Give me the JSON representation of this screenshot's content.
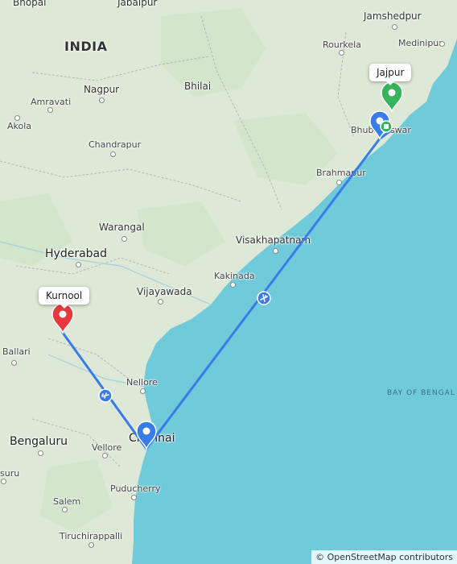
{
  "map": {
    "country_label": "INDIA",
    "sea_label": "BAY OF BENGAL",
    "cities": {
      "bhopal": "Bhopal",
      "jabalpur": "Jabalpur",
      "jamshedpur": "Jamshedpur",
      "rourkela": "Rourkela",
      "medinipur": "Medinipur",
      "nagpur": "Nagpur",
      "bhilai": "Bhilai",
      "amravati": "Amravati",
      "akola": "Akola",
      "chandrapur": "Chandrapur",
      "bhubaneswar": "Bhubaneswar",
      "brahmapur": "Brahmapur",
      "warangal": "Warangal",
      "visakhapatnam": "Visakhapatnam",
      "hyderabad": "Hyderabad",
      "kakinada": "Kakinada",
      "vijayawada": "Vijayawada",
      "ballari": "Ballari",
      "nellore": "Nellore",
      "bengaluru": "Bengaluru",
      "chennai": "Chennai",
      "vellore": "Vellore",
      "suru": "suru",
      "puducherry": "Puducherry",
      "salem": "Salem",
      "tiruchirappalli": "Tiruchirappalli"
    }
  },
  "markers": {
    "origin": {
      "label": "Kurnool",
      "color": "#e8383d"
    },
    "destination": {
      "label": "Jajpur",
      "color": "#35b45c"
    },
    "stopover": "Chennai",
    "stopover2": "Bhubaneswar",
    "waypoint_color": "#3a7bea"
  },
  "route": {
    "color": "#3a7bea",
    "legs": [
      "Kurnool → Chennai",
      "Chennai → Bhubaneswar",
      "Bhubaneswar → Jajpur"
    ],
    "mode_icon": "airplane-icon"
  },
  "colors": {
    "land": "#dde9d6",
    "sea": "#6fcad9"
  },
  "attribution": "© OpenStreetMap contributors"
}
